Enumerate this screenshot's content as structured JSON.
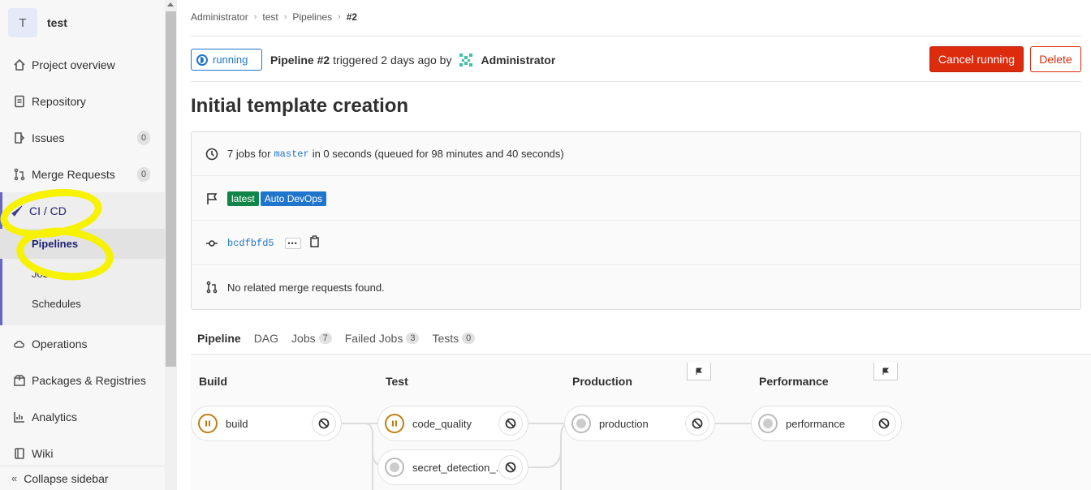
{
  "sidebar": {
    "project_initial": "T",
    "project_name": "test",
    "items": [
      {
        "label": "Project overview",
        "icon": "home-icon"
      },
      {
        "label": "Repository",
        "icon": "document-icon"
      },
      {
        "label": "Issues",
        "icon": "issues-icon",
        "count": "0"
      },
      {
        "label": "Merge Requests",
        "icon": "merge-request-icon",
        "count": "0"
      },
      {
        "label": "CI / CD",
        "icon": "rocket-icon"
      },
      {
        "label": "Operations",
        "icon": "cloud-gear-icon"
      },
      {
        "label": "Packages & Registries",
        "icon": "package-icon"
      },
      {
        "label": "Analytics",
        "icon": "chart-icon"
      },
      {
        "label": "Wiki",
        "icon": "book-icon"
      }
    ],
    "ci_sub": [
      "Pipelines",
      "Jobs",
      "Schedules"
    ],
    "collapse_label": "Collapse sidebar"
  },
  "breadcrumb": [
    "Administrator",
    "test",
    "Pipelines",
    "#2"
  ],
  "header": {
    "status": "running",
    "pipeline_label": "Pipeline #2",
    "triggered_text": "triggered 2 days ago by",
    "user": "Administrator",
    "cancel_label": "Cancel running",
    "delete_label": "Delete"
  },
  "title": "Initial template creation",
  "info": {
    "jobs_prefix": "7 jobs for",
    "branch": "master",
    "jobs_suffix": "in 0 seconds (queued for 98 minutes and 40 seconds)",
    "badges": [
      {
        "label": "latest",
        "color": "#108548"
      },
      {
        "label": "Auto DevOps",
        "color": "#1f75cb"
      }
    ],
    "commit": "bcdfbfd5",
    "mr_text": "No related merge requests found."
  },
  "tabs": [
    {
      "label": "Pipeline",
      "count": null
    },
    {
      "label": "DAG",
      "count": null
    },
    {
      "label": "Jobs",
      "count": "7"
    },
    {
      "label": "Failed Jobs",
      "count": "3"
    },
    {
      "label": "Tests",
      "count": "0"
    }
  ],
  "stages": [
    {
      "name": "Build",
      "jobs": [
        {
          "name": "build",
          "status": "paused"
        }
      ]
    },
    {
      "name": "Test",
      "jobs": [
        {
          "name": "code_quality",
          "status": "paused"
        },
        {
          "name": "secret_detection_...",
          "status": "created"
        }
      ]
    },
    {
      "name": "Production",
      "jobs": [
        {
          "name": "production",
          "status": "created"
        }
      ]
    },
    {
      "name": "Performance",
      "jobs": [
        {
          "name": "performance",
          "status": "created"
        }
      ]
    }
  ],
  "colors": {
    "accent": "#6666c4",
    "running": "#1f75cb",
    "danger": "#dd2b0e",
    "paused": "#c17d10",
    "highlight": "#f6f200"
  }
}
